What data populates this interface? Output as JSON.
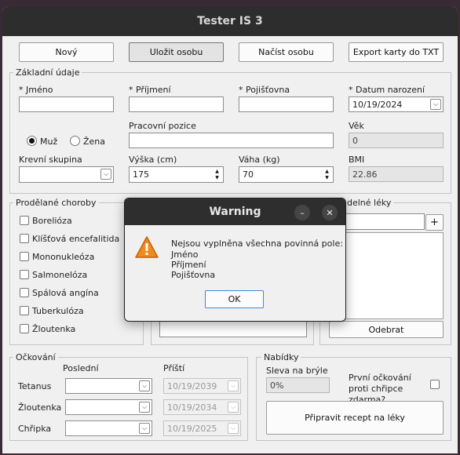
{
  "window": {
    "title": "Tester IS 3"
  },
  "toolbar": {
    "new": "Nový",
    "save": "Uložit osobu",
    "load": "Načíst osobu",
    "export": "Export karty do TXT"
  },
  "basic": {
    "legend": "Základní údaje",
    "name_label": "* Jméno",
    "name_value": "",
    "surname_label": "* Příjmení",
    "surname_value": "",
    "insurance_label": "* Pojišťovna",
    "insurance_value": "",
    "dob_label": "* Datum narození",
    "dob_value": "10/19/2024",
    "gender_male": "Muž",
    "gender_female": "Žena",
    "gender_selected": "Muž",
    "position_label": "Pracovní pozice",
    "position_value": "",
    "age_label": "Věk",
    "age_value": "0",
    "blood_label": "Krevní skupina",
    "blood_value": "",
    "height_label": "Výška (cm)",
    "height_value": "175",
    "weight_label": "Váha (kg)",
    "weight_value": "70",
    "bmi_label": "BMI",
    "bmi_value": "22.86"
  },
  "diseases": {
    "legend": "Prodělané choroby",
    "items": [
      "Borelióza",
      "Klíšťová encefalitida",
      "Mononukleóza",
      "Salmonelóza",
      "Spálová angína",
      "Tuberkulóza",
      "Žloutenka"
    ]
  },
  "meds": {
    "legend_partial": "delné léky",
    "add": "+",
    "remove": "Odebrat"
  },
  "vaccination": {
    "legend": "Očkování",
    "col_last": "Poslední",
    "col_next": "Příští",
    "rows": [
      {
        "name": "Tetanus",
        "last": "",
        "next": "10/19/2039"
      },
      {
        "name": "Žloutenka",
        "last": "",
        "next": "10/19/2034"
      },
      {
        "name": "Chřipka",
        "last": "",
        "next": "10/19/2025"
      }
    ]
  },
  "offers": {
    "legend": "Nabídky",
    "discount_label": "Sleva na brýle",
    "discount_value": "0%",
    "flu_label_1": "První očkování",
    "flu_label_2": "proti chřipce",
    "flu_label_3": "zdarma?",
    "prescription": "Připravit recept na léky"
  },
  "dialog": {
    "title": "Warning",
    "message": "Nejsou vyplněna všechna povinná pole:",
    "fields": [
      "Jméno",
      "Příjmení",
      "Pojišťovna"
    ],
    "ok": "OK"
  }
}
